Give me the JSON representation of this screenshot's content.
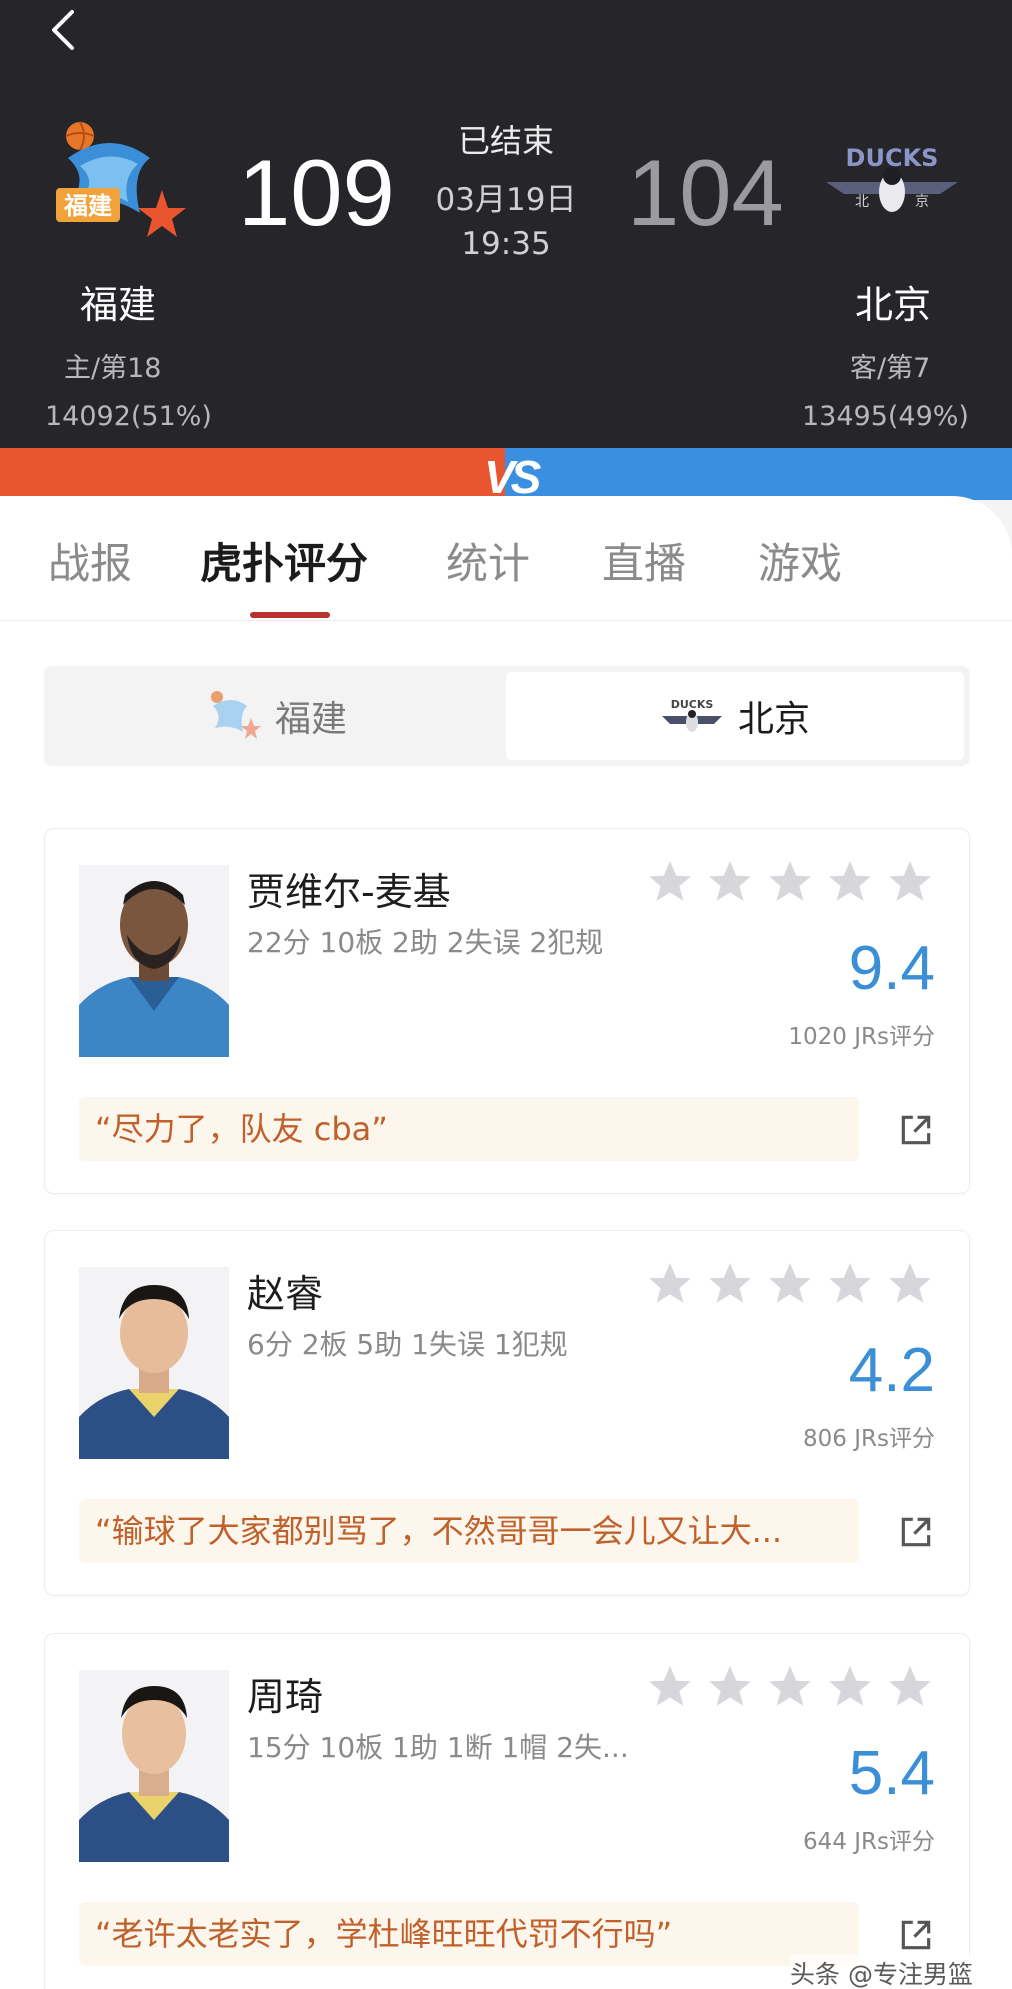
{
  "header": {
    "back_icon": "chevron-left-icon",
    "status": "已结束",
    "date": "03月19日",
    "time": "19:35",
    "home": {
      "name": "福建",
      "score": "109",
      "rank": "主/第18",
      "votes": "14092(51%)",
      "color": "#e8552f",
      "logo": "fujian-sturgeons-logo"
    },
    "away": {
      "name": "北京",
      "score": "104",
      "rank": "客/第7",
      "votes": "13495(49%)",
      "color": "#3a8fe0",
      "logo": "beijing-ducks-logo",
      "logo_text": "DUCKS"
    },
    "vs_label": "VS"
  },
  "tabs": [
    {
      "label": "战报",
      "active": false
    },
    {
      "label": "虎扑评分",
      "active": true
    },
    {
      "label": "统计",
      "active": false
    },
    {
      "label": "直播",
      "active": false
    },
    {
      "label": "游戏",
      "active": false
    }
  ],
  "team_switch": {
    "home": "福建",
    "away": "北京",
    "selected": "北京"
  },
  "players": [
    {
      "name": "贾维尔-麦基",
      "stats": "22分 10板 2助 2失误 2犯规",
      "rating": "9.4",
      "count": "1020 JRs评分",
      "comment": "“尽力了，队友 cba”"
    },
    {
      "name": "赵睿",
      "stats": "6分 2板 5助 1失误 1犯规",
      "rating": "4.2",
      "count": "806 JRs评分",
      "comment": "“输球了大家都别骂了，不然哥哥一会儿又让大..."
    },
    {
      "name": "周琦",
      "stats": "15分 10板 1助 1断 1帽 2失...",
      "rating": "5.4",
      "count": "644 JRs评分",
      "comment": "“老许太老实了，学杜峰旺旺代罚不行吗”"
    }
  ],
  "watermark": "头条 @专注男篮",
  "colors": {
    "accent": "#b8322e",
    "rating": "#3b8fd6",
    "comment_text": "#c0612b"
  }
}
